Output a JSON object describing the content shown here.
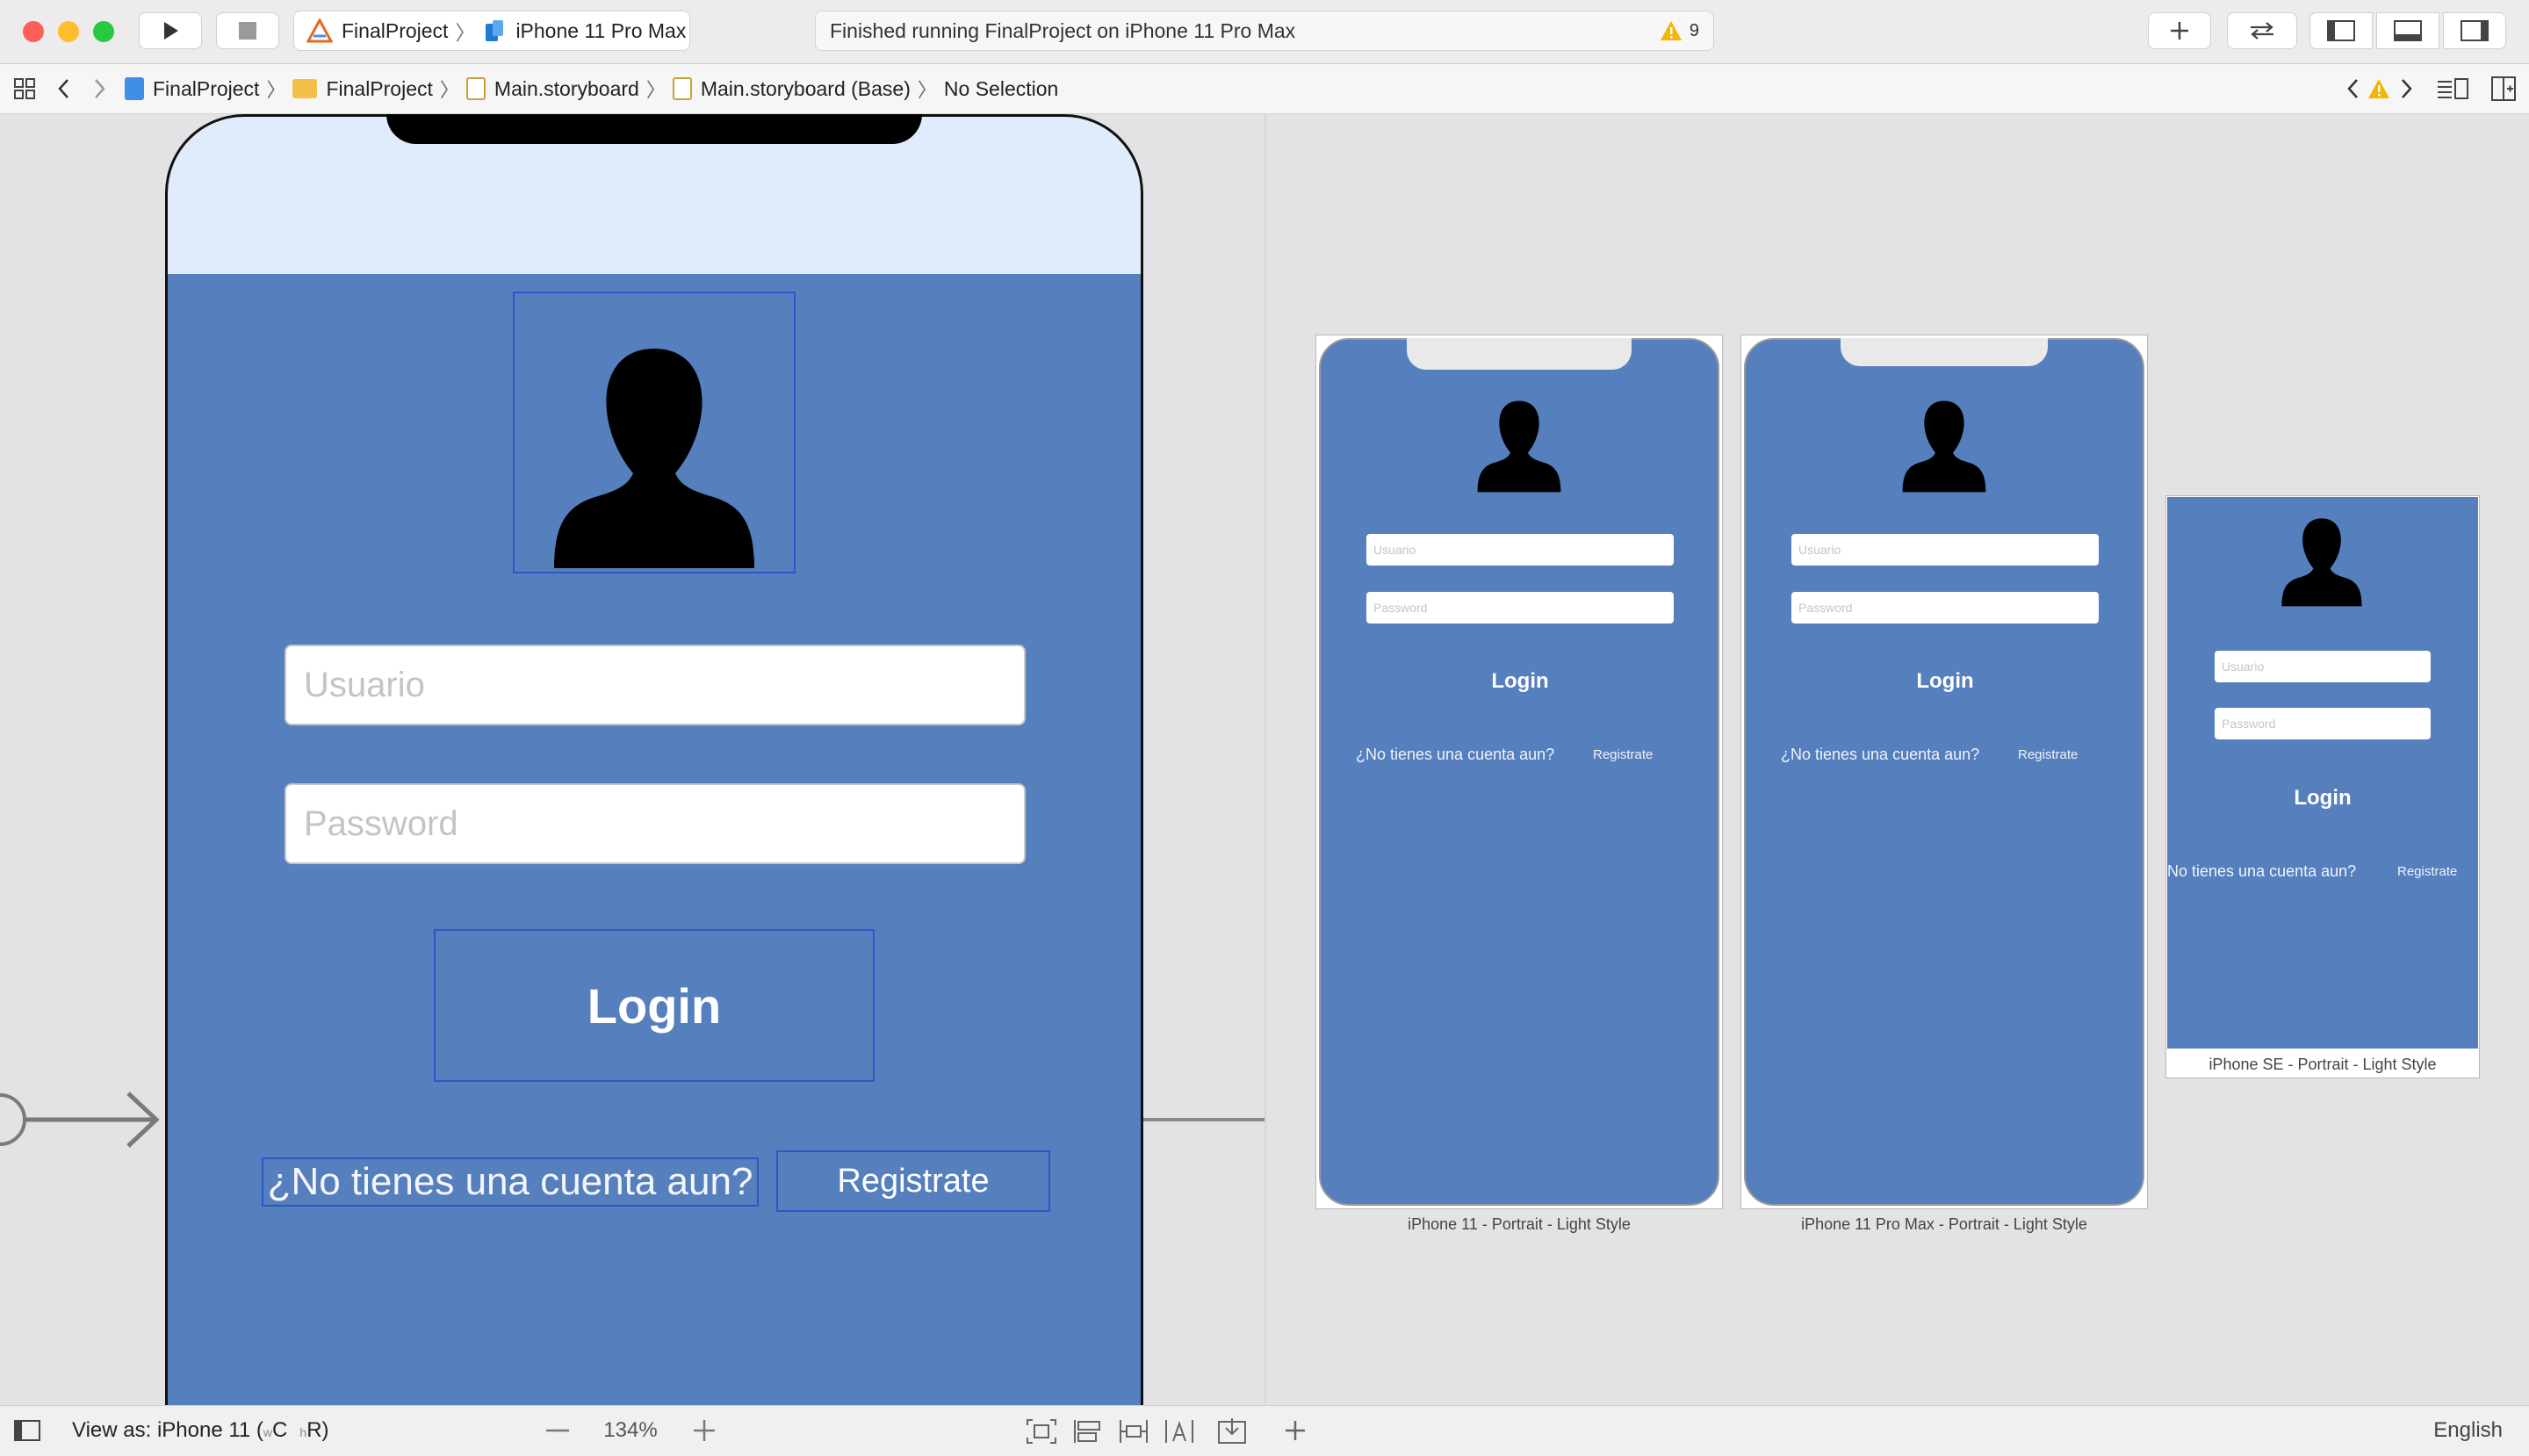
{
  "toolbar": {
    "scheme_project": "FinalProject",
    "scheme_device": "iPhone 11 Pro Max",
    "activity_status": "Finished running FinalProject on iPhone 11 Pro Max",
    "warning_count": "9"
  },
  "jumpbar": {
    "crumbs": [
      "FinalProject",
      "FinalProject",
      "Main.storyboard",
      "Main.storyboard (Base)",
      "No Selection"
    ]
  },
  "scene": {
    "username_placeholder": "Usuario",
    "password_placeholder": "Password",
    "login_label": "Login",
    "question_label": "¿No tienes una cuenta aun?",
    "register_label": "Registrate"
  },
  "previews": [
    {
      "caption": "iPhone 11 - Portrait - Light Style",
      "username": "Usuario",
      "password": "Password",
      "login": "Login",
      "question": "¿No tienes una cuenta aun?",
      "register": "Registrate"
    },
    {
      "caption": "iPhone 11 Pro Max - Portrait - Light Style",
      "username": "Usuario",
      "password": "Password",
      "login": "Login",
      "question": "¿No tienes una cuenta aun?",
      "register": "Registrate"
    },
    {
      "caption": "iPhone SE - Portrait - Light Style",
      "username": "Usuario",
      "password": "Password",
      "login": "Login",
      "question": "No tienes una cuenta aun?",
      "register": "Registrate"
    }
  ],
  "bottombar": {
    "view_as_prefix": "View as: iPhone 11 (",
    "size_w": "w",
    "size_c": "C",
    "size_h": "h",
    "size_r": "R)",
    "zoom": "134%",
    "language": "English"
  },
  "colors": {
    "view_background": "#567fbe",
    "selection": "#2f56c9",
    "warning": "#f5b400"
  }
}
